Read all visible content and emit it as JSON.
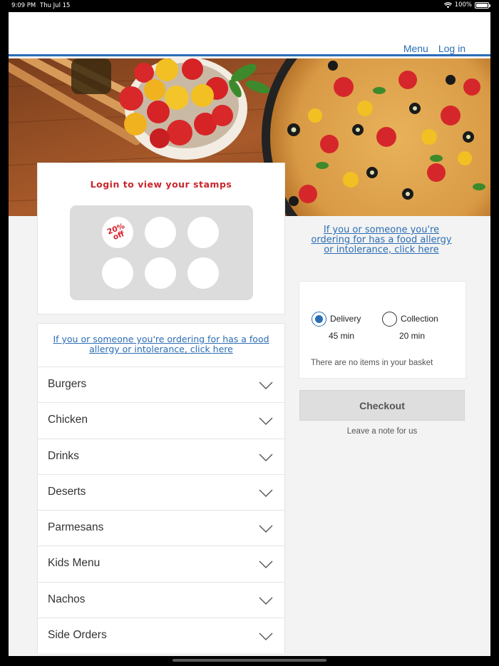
{
  "status_bar": {
    "time": "9:09 PM",
    "date": "Thu Jul 15",
    "battery": "100%"
  },
  "header": {
    "nav": {
      "menu": "Menu",
      "login": "Log in"
    }
  },
  "stamps": {
    "title": "Login to view your stamps",
    "promo_line1": "20%",
    "promo_line2": "off",
    "total_slots": 6
  },
  "allergy_notice": "If you or someone you're ordering for has a food allergy or intolerance, click here",
  "menu_categories": [
    {
      "label": "Burgers"
    },
    {
      "label": "Chicken"
    },
    {
      "label": "Drinks"
    },
    {
      "label": "Deserts"
    },
    {
      "label": "Parmesans"
    },
    {
      "label": "Kids Menu"
    },
    {
      "label": "Nachos"
    },
    {
      "label": "Side Orders"
    }
  ],
  "basket": {
    "delivery": {
      "label": "Delivery",
      "time": "45 min",
      "selected": true
    },
    "collection": {
      "label": "Collection",
      "time": "20 min",
      "selected": false
    },
    "empty_text": "There are no items in your basket"
  },
  "checkout_label": "Checkout",
  "note_label": "Leave a note for us",
  "colors": {
    "accent": "#2a6db5",
    "brand_red": "#c8262c",
    "background": "#f3f3f3"
  }
}
